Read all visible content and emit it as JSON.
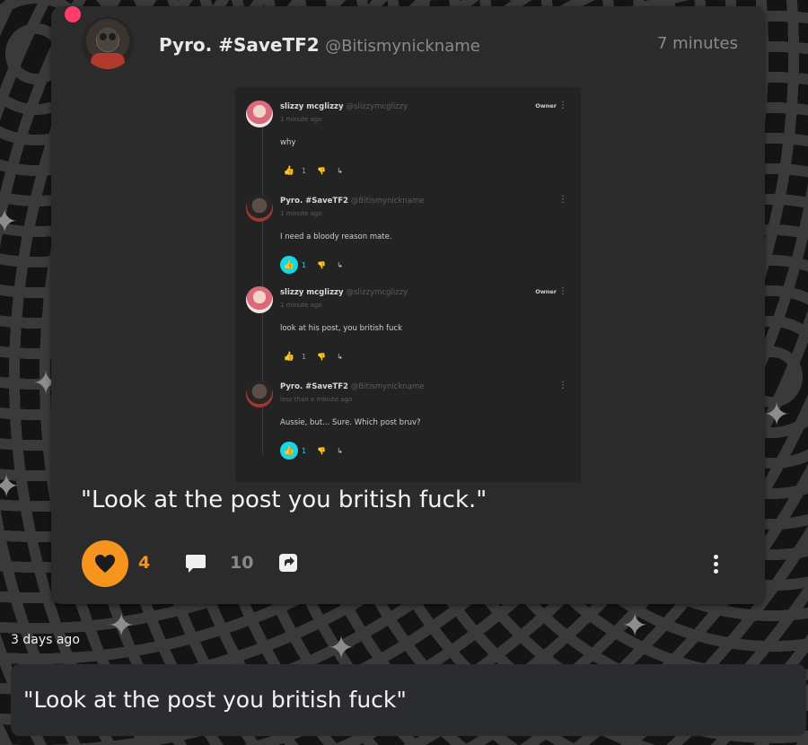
{
  "post": {
    "author_name": "Pyro. #SaveTF2",
    "author_handle": "@Bitismynickname",
    "time": "7 minutes",
    "caption": "\"Look at the post you british fuck.\"",
    "like_count": "4",
    "comment_count": "10",
    "liked": true
  },
  "screenshot": {
    "comments": [
      {
        "name": "slizzy mcglizzy",
        "handle": "@slizzymcglizzy",
        "time": "1 minute ago",
        "text": "why",
        "badge": "Owner",
        "likes": "1",
        "liked": false,
        "avatar": "pink"
      },
      {
        "name": "Pyro. #SaveTF2",
        "handle": "@Bitismynickname",
        "time": "1 minute ago",
        "text": "I need a bloody reason mate.",
        "badge": "",
        "likes": "1",
        "liked": true,
        "avatar": "dark"
      },
      {
        "name": "slizzy mcglizzy",
        "handle": "@slizzymcglizzy",
        "time": "1 minute ago",
        "text": "look at his post, you british fuck",
        "badge": "Owner",
        "likes": "1",
        "liked": false,
        "avatar": "pink"
      },
      {
        "name": "Pyro. #SaveTF2",
        "handle": "@Bitismynickname",
        "time": "less than a minute ago",
        "text": "Aussie, but... Sure. Which post bruv?",
        "badge": "",
        "likes": "1",
        "liked": true,
        "avatar": "dark"
      }
    ]
  },
  "footer": {
    "timestamp": "3 days ago",
    "description": "\"Look at the post you british fuck\""
  },
  "colors": {
    "accent": "#f6941e",
    "liked_cyan": "#13d9e6",
    "unread_dot": "#ff3d6a"
  },
  "icons": {
    "like": "heart-icon",
    "comment": "speech-bubble-icon",
    "share": "share-icon",
    "more": "more-vertical-icon"
  }
}
